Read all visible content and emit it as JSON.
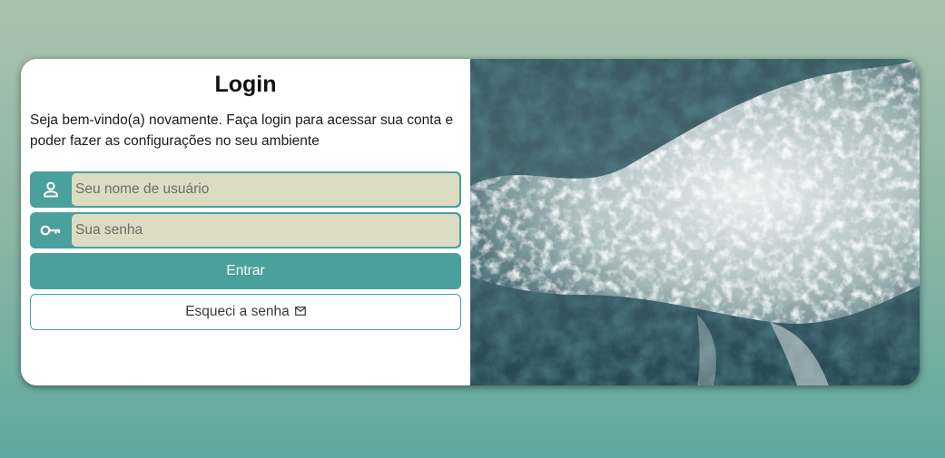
{
  "login": {
    "title": "Login",
    "subtitle": "Seja bem-vindo(a) novamente. Faça login para acessar sua conta e poder fazer as configurações no seu ambiente",
    "username": {
      "placeholder": "Seu nome de usuário",
      "value": "",
      "icon": "user-icon"
    },
    "password": {
      "placeholder": "Sua senha",
      "value": "",
      "icon": "key-icon"
    },
    "submit_label": "Entrar",
    "forgot_label": "Esqueci a senha",
    "forgot_icon": "envelope-icon"
  },
  "hero_image": {
    "subject": "ocean-waves-image"
  },
  "colors": {
    "accent": "#4aa09c",
    "input_bg": "#dcdcc3",
    "card_bg": "#ffffff"
  }
}
